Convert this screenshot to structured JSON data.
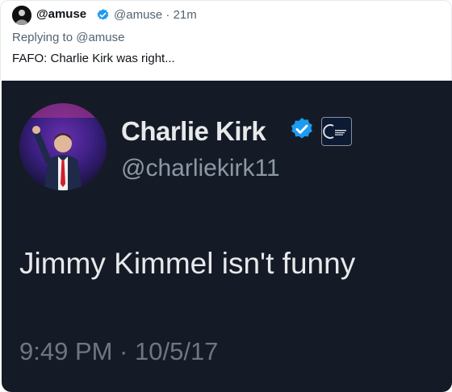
{
  "reply": {
    "author_name": "@amuse",
    "author_handle": "@amuse · 21m",
    "replying_to": "Replying to @amuse",
    "text": "FAFO: Charlie Kirk was right..."
  },
  "embedded_tweet": {
    "name": "Charlie Kirk",
    "handle": "@charliekirk11",
    "text": "Jimmy Kimmel isn't funny",
    "timestamp": "9:49 PM · 10/5/17",
    "verified_color": "#1d9bf0",
    "background_color": "#151b26"
  }
}
